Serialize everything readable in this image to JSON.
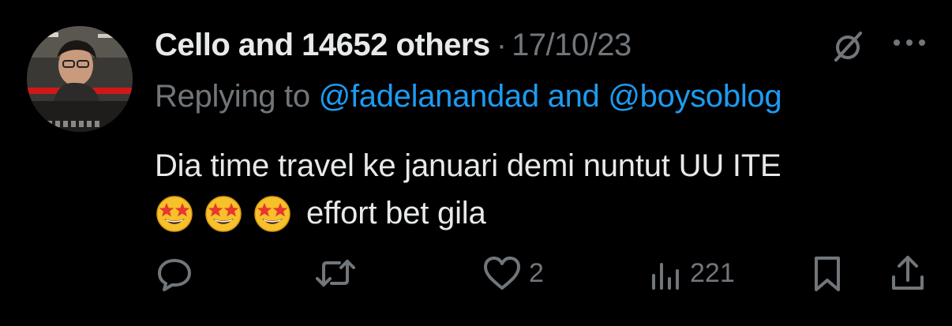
{
  "tweet": {
    "author_name": "Cello and 14652 others",
    "separator": "·",
    "date": "17/10/23",
    "reply_prefix": "Replying to",
    "mention_1": "@fadelanandad",
    "reply_and": "and",
    "mention_2": "@boysoblog",
    "text_line_1": "Dia time travel ke januari demi nuntut UU ITE",
    "text_line_2": "effort bet gila",
    "emojis": [
      "star-struck",
      "star-struck",
      "star-struck"
    ]
  },
  "actions": {
    "reply_icon": "reply-icon",
    "retweet_icon": "retweet-icon",
    "like_icon": "heart-icon",
    "like_count": "2",
    "views_icon": "views-icon",
    "views_count": "221",
    "bookmark_icon": "bookmark-icon",
    "share_icon": "share-icon"
  },
  "colors": {
    "background": "#000000",
    "primary_text": "#e7e9ea",
    "secondary_text": "#71767b",
    "link": "#1d9bf0"
  }
}
